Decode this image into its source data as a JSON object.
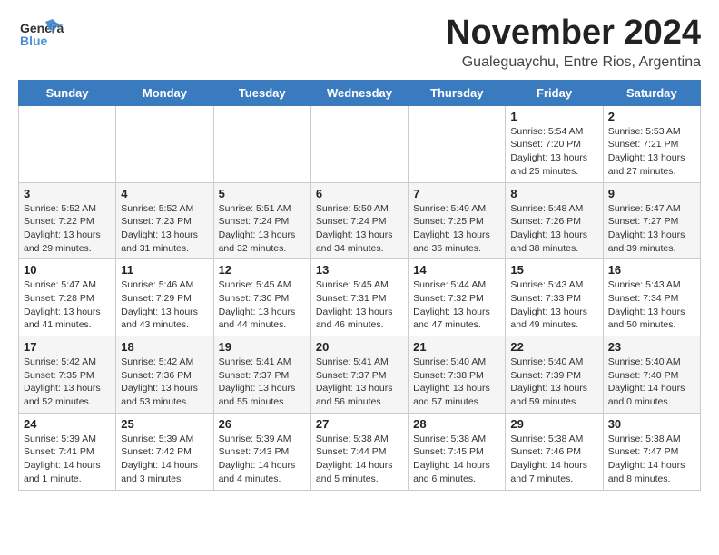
{
  "logo": {
    "general": "General",
    "blue": "Blue"
  },
  "title": {
    "month": "November 2024",
    "location": "Gualeguaychu, Entre Rios, Argentina"
  },
  "headers": [
    "Sunday",
    "Monday",
    "Tuesday",
    "Wednesday",
    "Thursday",
    "Friday",
    "Saturday"
  ],
  "weeks": [
    [
      {
        "day": "",
        "info": ""
      },
      {
        "day": "",
        "info": ""
      },
      {
        "day": "",
        "info": ""
      },
      {
        "day": "",
        "info": ""
      },
      {
        "day": "",
        "info": ""
      },
      {
        "day": "1",
        "info": "Sunrise: 5:54 AM\nSunset: 7:20 PM\nDaylight: 13 hours\nand 25 minutes."
      },
      {
        "day": "2",
        "info": "Sunrise: 5:53 AM\nSunset: 7:21 PM\nDaylight: 13 hours\nand 27 minutes."
      }
    ],
    [
      {
        "day": "3",
        "info": "Sunrise: 5:52 AM\nSunset: 7:22 PM\nDaylight: 13 hours\nand 29 minutes."
      },
      {
        "day": "4",
        "info": "Sunrise: 5:52 AM\nSunset: 7:23 PM\nDaylight: 13 hours\nand 31 minutes."
      },
      {
        "day": "5",
        "info": "Sunrise: 5:51 AM\nSunset: 7:24 PM\nDaylight: 13 hours\nand 32 minutes."
      },
      {
        "day": "6",
        "info": "Sunrise: 5:50 AM\nSunset: 7:24 PM\nDaylight: 13 hours\nand 34 minutes."
      },
      {
        "day": "7",
        "info": "Sunrise: 5:49 AM\nSunset: 7:25 PM\nDaylight: 13 hours\nand 36 minutes."
      },
      {
        "day": "8",
        "info": "Sunrise: 5:48 AM\nSunset: 7:26 PM\nDaylight: 13 hours\nand 38 minutes."
      },
      {
        "day": "9",
        "info": "Sunrise: 5:47 AM\nSunset: 7:27 PM\nDaylight: 13 hours\nand 39 minutes."
      }
    ],
    [
      {
        "day": "10",
        "info": "Sunrise: 5:47 AM\nSunset: 7:28 PM\nDaylight: 13 hours\nand 41 minutes."
      },
      {
        "day": "11",
        "info": "Sunrise: 5:46 AM\nSunset: 7:29 PM\nDaylight: 13 hours\nand 43 minutes."
      },
      {
        "day": "12",
        "info": "Sunrise: 5:45 AM\nSunset: 7:30 PM\nDaylight: 13 hours\nand 44 minutes."
      },
      {
        "day": "13",
        "info": "Sunrise: 5:45 AM\nSunset: 7:31 PM\nDaylight: 13 hours\nand 46 minutes."
      },
      {
        "day": "14",
        "info": "Sunrise: 5:44 AM\nSunset: 7:32 PM\nDaylight: 13 hours\nand 47 minutes."
      },
      {
        "day": "15",
        "info": "Sunrise: 5:43 AM\nSunset: 7:33 PM\nDaylight: 13 hours\nand 49 minutes."
      },
      {
        "day": "16",
        "info": "Sunrise: 5:43 AM\nSunset: 7:34 PM\nDaylight: 13 hours\nand 50 minutes."
      }
    ],
    [
      {
        "day": "17",
        "info": "Sunrise: 5:42 AM\nSunset: 7:35 PM\nDaylight: 13 hours\nand 52 minutes."
      },
      {
        "day": "18",
        "info": "Sunrise: 5:42 AM\nSunset: 7:36 PM\nDaylight: 13 hours\nand 53 minutes."
      },
      {
        "day": "19",
        "info": "Sunrise: 5:41 AM\nSunset: 7:37 PM\nDaylight: 13 hours\nand 55 minutes."
      },
      {
        "day": "20",
        "info": "Sunrise: 5:41 AM\nSunset: 7:37 PM\nDaylight: 13 hours\nand 56 minutes."
      },
      {
        "day": "21",
        "info": "Sunrise: 5:40 AM\nSunset: 7:38 PM\nDaylight: 13 hours\nand 57 minutes."
      },
      {
        "day": "22",
        "info": "Sunrise: 5:40 AM\nSunset: 7:39 PM\nDaylight: 13 hours\nand 59 minutes."
      },
      {
        "day": "23",
        "info": "Sunrise: 5:40 AM\nSunset: 7:40 PM\nDaylight: 14 hours\nand 0 minutes."
      }
    ],
    [
      {
        "day": "24",
        "info": "Sunrise: 5:39 AM\nSunset: 7:41 PM\nDaylight: 14 hours\nand 1 minute."
      },
      {
        "day": "25",
        "info": "Sunrise: 5:39 AM\nSunset: 7:42 PM\nDaylight: 14 hours\nand 3 minutes."
      },
      {
        "day": "26",
        "info": "Sunrise: 5:39 AM\nSunset: 7:43 PM\nDaylight: 14 hours\nand 4 minutes."
      },
      {
        "day": "27",
        "info": "Sunrise: 5:38 AM\nSunset: 7:44 PM\nDaylight: 14 hours\nand 5 minutes."
      },
      {
        "day": "28",
        "info": "Sunrise: 5:38 AM\nSunset: 7:45 PM\nDaylight: 14 hours\nand 6 minutes."
      },
      {
        "day": "29",
        "info": "Sunrise: 5:38 AM\nSunset: 7:46 PM\nDaylight: 14 hours\nand 7 minutes."
      },
      {
        "day": "30",
        "info": "Sunrise: 5:38 AM\nSunset: 7:47 PM\nDaylight: 14 hours\nand 8 minutes."
      }
    ]
  ]
}
